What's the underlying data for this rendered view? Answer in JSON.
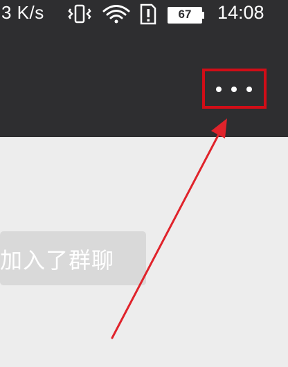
{
  "status_bar": {
    "network_speed": "3 K/s",
    "battery_level": "67",
    "time": "14:08",
    "icons": [
      "vibrate-icon",
      "wifi-icon",
      "sim-alert-icon",
      "battery-icon"
    ]
  },
  "header": {
    "more_button_label": "• • •"
  },
  "chat": {
    "system_message": "加入了群聊"
  },
  "annotation": {
    "highlight_color": "#d10d17",
    "arrow_color": "#e0232b"
  }
}
